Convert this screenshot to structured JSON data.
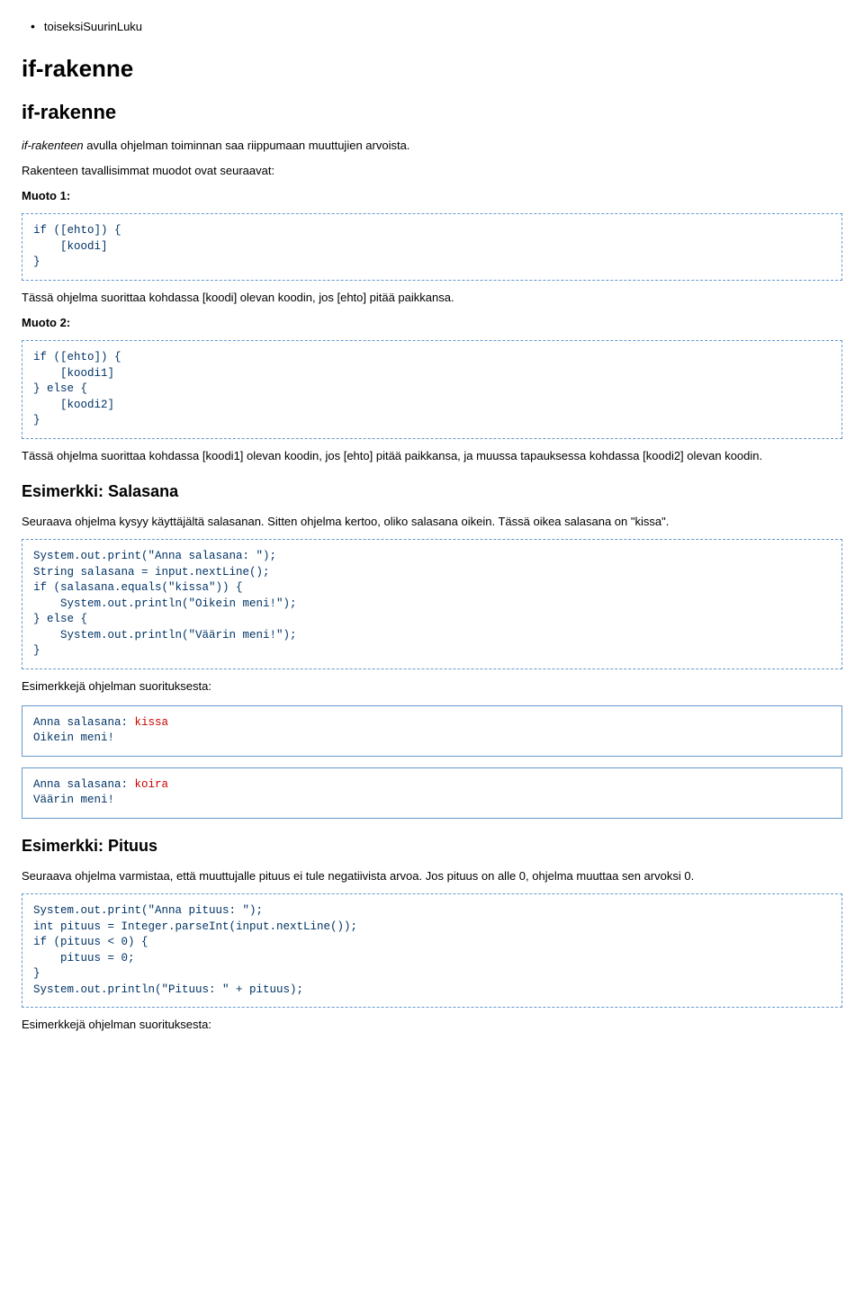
{
  "bullet": {
    "item1": "toiseksiSuurinLuku"
  },
  "h1": "if-rakenne",
  "h2": "if-rakenne",
  "intro": {
    "prefix": "if-rakenteen",
    "rest": " avulla ohjelman toiminnan saa riippumaan muuttujien arvoista."
  },
  "rakenteen_intro": "Rakenteen tavallisimmat muodot ovat seuraavat:",
  "muoto1_label": "Muoto 1:",
  "code_muoto1": "if ([ehto]) {\n    [koodi]\n}",
  "muoto1_after": "Tässä ohjelma suorittaa kohdassa [koodi] olevan koodin, jos [ehto] pitää paikkansa.",
  "muoto2_label": "Muoto 2:",
  "code_muoto2": "if ([ehto]) {\n    [koodi1]\n} else {\n    [koodi2]\n}",
  "muoto2_after": "Tässä ohjelma suorittaa kohdassa [koodi1] olevan koodin, jos [ehto] pitää paikkansa, ja muussa tapauksessa kohdassa [koodi2] olevan koodin.",
  "esim_salasana": "Esimerkki: Salasana",
  "salasana_intro": "Seuraava ohjelma kysyy käyttäjältä salasanan. Sitten ohjelma kertoo, oliko salasana oikein. Tässä oikea salasana on \"kissa\".",
  "code_salasana": "System.out.print(\"Anna salasana: \");\nString salasana = input.nextLine();\nif (salasana.equals(\"kissa\")) {\n    System.out.println(\"Oikein meni!\");\n} else {\n    System.out.println(\"Väärin meni!\");\n}",
  "esimerkkeja_text": "Esimerkkejä ohjelman suorituksesta:",
  "run1": {
    "line1a": "Anna salasana: ",
    "line1b": "kissa",
    "line2": "Oikein meni!"
  },
  "run2": {
    "line1a": "Anna salasana: ",
    "line1b": "koira",
    "line2": "Väärin meni!"
  },
  "esim_pituus": "Esimerkki: Pituus",
  "pituus_intro": "Seuraava ohjelma varmistaa, että muuttujalle pituus ei tule negatiivista arvoa. Jos pituus on alle 0, ohjelma muuttaa sen arvoksi 0.",
  "code_pituus": "System.out.print(\"Anna pituus: \");\nint pituus = Integer.parseInt(input.nextLine());\nif (pituus < 0) {\n    pituus = 0;\n}\nSystem.out.println(\"Pituus: \" + pituus);",
  "esimerkkeja_text2": "Esimerkkejä ohjelman suorituksesta:"
}
